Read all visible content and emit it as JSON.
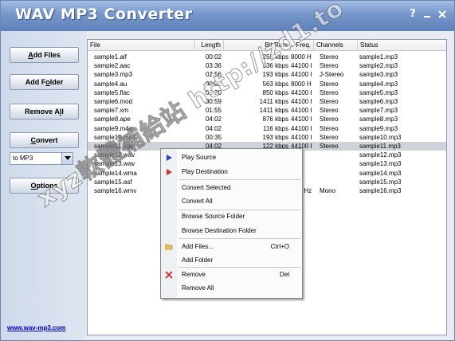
{
  "app": {
    "title": "WAV MP3 Converter",
    "help_button": "?",
    "minimize_button": "—",
    "close_button": "×"
  },
  "sidebar": {
    "add_files": {
      "underline": "A",
      "rest": "dd Files"
    },
    "add_folder": {
      "pre": "Add F",
      "underline": "o",
      "rest": "lder"
    },
    "remove_all": {
      "pre": "Remove A",
      "underline": "l",
      "rest": "l"
    },
    "convert": {
      "underline": "C",
      "rest": "onvert"
    },
    "format_select": {
      "value": "to MP3"
    },
    "options": {
      "underline": "O",
      "rest": "ptions"
    },
    "website_link": "www.wav-mp3.com"
  },
  "columns": [
    "File",
    "Length",
    "Bit Rate",
    "Freq.",
    "Channels",
    "Status"
  ],
  "files": [
    [
      "sample1.aif",
      "00:02",
      "256 kbps",
      "8000 Hz",
      "Stereo",
      "sample1.mp3"
    ],
    [
      "sample2.aac",
      "03:36",
      "136 kbps",
      "44100 Hz",
      "Stereo",
      "sample2.mp3"
    ],
    [
      "sample3.mp3",
      "02:56",
      "193 kbps",
      "44100 Hz",
      "J-Stereo",
      "sample3.mp3"
    ],
    [
      "sample4.au",
      "00:02",
      "563 kbps",
      "8000 Hz",
      "Stereo",
      "sample4.mp3"
    ],
    [
      "sample5.flac",
      "03:20",
      "850 kbps",
      "44100 Hz",
      "Stereo",
      "sample5.mp3"
    ],
    [
      "sample6.mod",
      "00:59",
      "1411 kbps",
      "44100 Hz",
      "Stereo",
      "sample6.mp3"
    ],
    [
      "sample7.xm",
      "01:55",
      "1411 kbps",
      "44100 Hz",
      "Stereo",
      "sample7.mp3"
    ],
    [
      "sample8.ape",
      "04:02",
      "876 kbps",
      "44100 Hz",
      "Stereo",
      "sample8.mp3"
    ],
    [
      "sample9.m4a",
      "04:02",
      "116 kbps",
      "44100 Hz",
      "Stereo",
      "sample9.mp3"
    ],
    [
      "sample10.mp4",
      "00:35",
      "193 kbps",
      "44100 Hz",
      "Stereo",
      "sample10.mp3"
    ],
    [
      "sample11.ogg",
      "04:02",
      "122 kbps",
      "44100 Hz",
      "Stereo",
      "sample11.mp3"
    ],
    [
      "sample12.wav",
      "",
      "",
      "",
      "",
      "sample12.mp3"
    ],
    [
      "sample13.wav",
      "",
      "",
      "",
      "",
      "sample13.mp3"
    ],
    [
      "sample14.wma",
      "",
      "",
      "",
      "",
      "sample14.mp3"
    ],
    [
      "sample15.asf",
      "",
      "",
      "",
      "",
      "sample15.mp3"
    ],
    [
      "sample16.wmv",
      "",
      "",
      "Hz",
      "Mono",
      "sample16.mp3"
    ]
  ],
  "selected_row": 10,
  "context_menu": {
    "play_source": "Play Source",
    "play_destination": "Play Destination",
    "convert_selected": "Convert Selected",
    "convert_all": "Convert All",
    "browse_source": "Browse Source Folder",
    "browse_destination": "Browse Destination Folder",
    "add_files": "Add Files...",
    "add_files_shortcut": "Ctrl+O",
    "add_folder": "Add Folder",
    "remove": "Remove",
    "remove_shortcut": "Del",
    "remove_all": "Remove All"
  },
  "watermark": "xyz軟體補給站 http://zd1.to",
  "colors": {
    "title_gradient_top": "#a4bde4",
    "title_gradient_bottom": "#5f82bb",
    "selection": "#cfd2d8",
    "link": "#0000cc",
    "play_icon": "#3344cc",
    "play_dest_icon": "#cc3333",
    "remove_icon": "#cc2222"
  }
}
